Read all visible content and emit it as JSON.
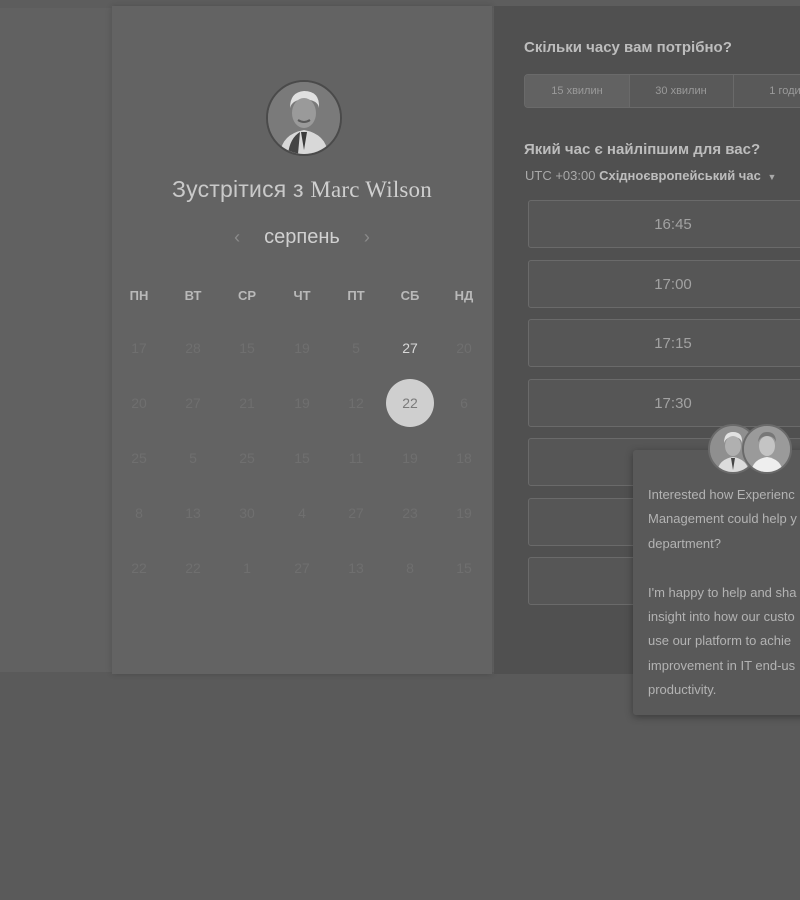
{
  "calendar": {
    "title_prefix": "Зустрітися з",
    "host_name": "Marc Wilson",
    "month": "серпень",
    "prev_icon": "chevron-left-icon",
    "next_icon": "chevron-right-icon",
    "weekdays": [
      "ПН",
      "ВТ",
      "СР",
      "ЧТ",
      "ПТ",
      "СБ",
      "НД"
    ],
    "weeks": [
      [
        "17",
        "28",
        "15",
        "19",
        "5",
        "27",
        "20"
      ],
      [
        "20",
        "27",
        "21",
        "19",
        "12",
        "22",
        "6"
      ],
      [
        "25",
        "5",
        "25",
        "15",
        "11",
        "19",
        "18"
      ],
      [
        "8",
        "13",
        "30",
        "4",
        "27",
        "23",
        "19"
      ],
      [
        "22",
        "22",
        "1",
        "27",
        "13",
        "8",
        "15"
      ]
    ],
    "selected_day": "22"
  },
  "scheduler": {
    "duration_question": "Скільки часу вам потрібно?",
    "durations": [
      "15 хвилин",
      "30 хвилин",
      "1 годи"
    ],
    "time_question": "Який час є найліпшим для вас?",
    "timezone_offset": "UTC +03:00",
    "timezone_name": "Східноєвропейський час",
    "timezone_icon": "caret-down-icon",
    "slots": [
      "16:45",
      "17:00",
      "17:15",
      "17:30",
      "",
      "",
      ""
    ]
  },
  "chat": {
    "message": "Interested how Experienc\nManagement could help y\ndepartment?\n\nI'm happy to help and sha\ninsight into how our custo\nuse our platform to achie\nimprovement in IT end-us\nproductivity."
  },
  "colors": {
    "selected_day_bg": "#cfcfcf",
    "panel_bg": "#505050"
  }
}
